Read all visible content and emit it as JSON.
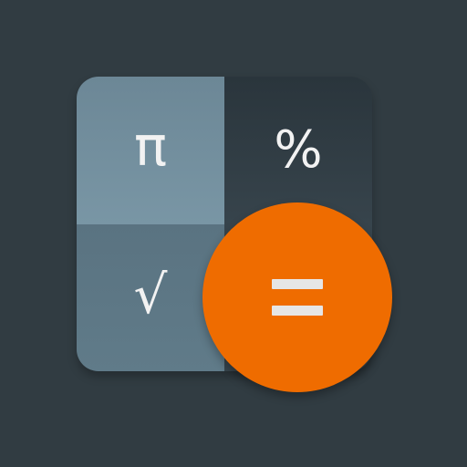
{
  "icon": {
    "keys": {
      "pi": "π",
      "percent": "%",
      "sqrt": "√"
    },
    "equals_icon": "equals-icon",
    "colors": {
      "background": "#313c42",
      "key_light": "#7996a5",
      "key_dark": "#2a353c",
      "key_mid": "#5a7381",
      "accent": "#ef6c00",
      "glyph": "#f2f2f2"
    }
  }
}
